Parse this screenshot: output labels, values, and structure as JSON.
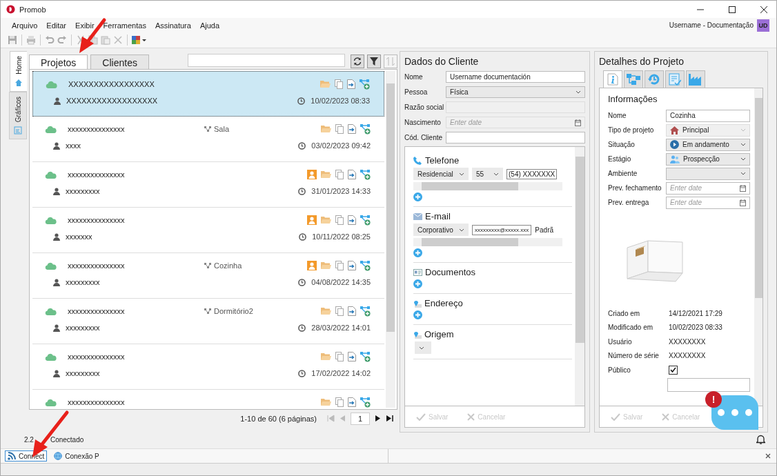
{
  "window": {
    "title": "Promob"
  },
  "menu": [
    "Arquivo",
    "Editar",
    "Exibir",
    "Ferramentas",
    "Assinatura",
    "Ajuda"
  ],
  "user": {
    "name": "Username - Documentação",
    "initials": "UD"
  },
  "side_tabs": [
    {
      "label": "Home",
      "selected": true
    },
    {
      "label": "Gráficos",
      "selected": false
    }
  ],
  "projects": {
    "tabs": [
      {
        "label": "Projetos",
        "selected": true
      },
      {
        "label": "Clientes",
        "selected": false
      }
    ],
    "rows": [
      {
        "name": "XXXXXXXXXXXXXXXXX",
        "client": "XXXXXXXXXXXXXXXXXX",
        "date": "10/02/2023 08:33",
        "assigned": false,
        "selected": true
      },
      {
        "name": "xxxxxxxxxxxxxxx",
        "environment": "Sala",
        "client": "xxxx",
        "date": "03/02/2023 09:42",
        "assigned": false,
        "selected": false
      },
      {
        "name": "xxxxxxxxxxxxxxx",
        "client": "xxxxxxxxx",
        "date": "31/01/2023 14:33",
        "assigned": true,
        "selected": false
      },
      {
        "name": "xxxxxxxxxxxxxxx",
        "client": "xxxxxxx",
        "date": "10/11/2022 08:25",
        "assigned": true,
        "selected": false
      },
      {
        "name": "xxxxxxxxxxxxxxx",
        "environment": "Cozinha",
        "client": "xxxxxxxxx",
        "date": "04/08/2022 14:35",
        "assigned": true,
        "selected": false
      },
      {
        "name": "xxxxxxxxxxxxxxx",
        "environment": "Dormitório2",
        "client": "xxxxxxxxx",
        "date": "28/03/2022 14:01",
        "assigned": false,
        "selected": false
      },
      {
        "name": "xxxxxxxxxxxxxxx",
        "client": "xxxxxxxxx",
        "date": "17/02/2022 14:02",
        "assigned": false,
        "selected": false
      },
      {
        "name": "xxxxxxxxxxxxxxx",
        "assigned": false,
        "selected": false
      }
    ],
    "pagination": {
      "summary": "1-10 de 60 (6 páginas)",
      "page": "1"
    }
  },
  "client": {
    "title": "Dados do Cliente",
    "fields": [
      {
        "label": "Nome",
        "kind": "text",
        "value": "Username documentación",
        "disabled": false
      },
      {
        "label": "Pessoa",
        "kind": "select",
        "value": "Física",
        "disabled": false
      },
      {
        "label": "Razão social",
        "kind": "text",
        "disabled": true
      },
      {
        "label": "Nascimento",
        "kind": "date",
        "placeholder": "Enter date",
        "disabled": true
      },
      {
        "label": "Cód. Cliente",
        "kind": "text",
        "disabled": false
      }
    ],
    "sections": [
      {
        "title": "Telefone",
        "kind": "phone",
        "type": "Residencial",
        "code": "55",
        "number": "(54) XXXXXXX"
      },
      {
        "title": "E-mail",
        "kind": "email",
        "type": "Corporativo",
        "address": "xxxxxxxxx@xxxxx.xxx",
        "note": "Padrã"
      },
      {
        "title": "Documentos",
        "kind": "add"
      },
      {
        "title": "Endereço",
        "kind": "add"
      },
      {
        "title": "Origem",
        "kind": "choice"
      }
    ],
    "buttons": [
      {
        "label": "Salvar",
        "kind": "save",
        "disabled": true
      },
      {
        "label": "Cancelar",
        "kind": "cancel",
        "disabled": true
      }
    ]
  },
  "details": {
    "title": "Detalhes do Projeto",
    "tabs": [
      {
        "selected": true
      },
      {
        "selected": false
      },
      {
        "selected": false
      },
      {
        "selected": false
      },
      {
        "selected": false
      }
    ],
    "section": "Informações",
    "fields": [
      {
        "label": "Nome",
        "kind": "text",
        "value": "Cozinha",
        "disabled": false
      },
      {
        "label": "Tipo de projeto",
        "kind": "select",
        "value": "Principal",
        "disabled": true
      },
      {
        "label": "Situação",
        "kind": "select",
        "value": "Em andamento",
        "disabled": false
      },
      {
        "label": "Estágio",
        "kind": "select",
        "value": "Prospecção",
        "disabled": false
      },
      {
        "label": "Ambiente",
        "kind": "select",
        "disabled": false
      },
      {
        "label": "Prev. fechamento",
        "kind": "date",
        "placeholder": "Enter date",
        "disabled": false
      },
      {
        "label": "Prev. entrega",
        "kind": "date",
        "placeholder": "Enter date",
        "disabled": false
      }
    ],
    "info": [
      {
        "label": "Criado em",
        "kind": "text",
        "value": "14/12/2021 17:29"
      },
      {
        "label": "Modificado em",
        "kind": "text",
        "value": "10/02/2023 08:33"
      },
      {
        "label": "Usuário",
        "kind": "text",
        "value": "XXXXXXXX"
      },
      {
        "label": "Número de série",
        "kind": "text",
        "value": "XXXXXXXX"
      },
      {
        "label": "Público",
        "kind": "check",
        "checked": true
      }
    ],
    "buttons": [
      {
        "label": "Salvar",
        "kind": "save",
        "disabled": true
      },
      {
        "label": "Cancelar",
        "kind": "cancel",
        "disabled": true
      }
    ]
  },
  "status": {
    "version": "2.2",
    "connection": "Conectado"
  },
  "taskbar": [
    {
      "label": "Connect",
      "selected": true
    },
    {
      "label": "Conexão P",
      "selected": false
    }
  ],
  "chat": {
    "badge": "!"
  }
}
